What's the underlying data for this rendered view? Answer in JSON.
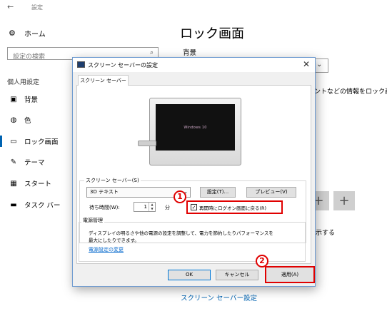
{
  "app": {
    "back_glyph": "←",
    "title": "設定"
  },
  "nav": {
    "home": {
      "icon": "gear-icon",
      "glyph": "⚙",
      "label": "ホーム"
    },
    "search": {
      "placeholder": "設定の検索",
      "icon": "search-icon",
      "glyph": "⌕"
    },
    "section_label": "個人用設定",
    "items": [
      {
        "icon": "picture-icon",
        "glyph": "▣",
        "label": "背景"
      },
      {
        "icon": "palette-icon",
        "glyph": "◍",
        "label": "色"
      },
      {
        "icon": "lock-screen-icon",
        "glyph": "▭",
        "label": "ロック画面",
        "active": true
      },
      {
        "icon": "theme-icon",
        "glyph": "✎",
        "label": "テーマ"
      },
      {
        "icon": "start-icon",
        "glyph": "▦",
        "label": "スタート"
      },
      {
        "icon": "taskbar-icon",
        "glyph": "▬",
        "label": "タスク バー"
      }
    ]
  },
  "main": {
    "title": "ロック画面",
    "background_label": "背景",
    "dropdown_chevron": "⌄",
    "info_text_partial": "ントなどの情報をロック画",
    "tile_glyph": "+",
    "show_text_partial": "示する",
    "screen_saver_link": "スクリーン セーバー設定"
  },
  "dialog": {
    "title": "スクリーン セーバーの設定",
    "close_glyph": "✕",
    "tab": "スクリーン セーバー",
    "preview_text": "Windows 10",
    "screensaver_group": "スクリーン セーバー(S)",
    "selected_screensaver": "3D テキスト",
    "select_chevron": "⌄",
    "settings_button": "設定(T)...",
    "preview_button": "プレビュー(V)",
    "wait_label": "待ち時間(W):",
    "wait_value": "1",
    "wait_unit": "分",
    "resume_checked_glyph": "✓",
    "resume_label": "再開時にログオン画面に戻る(R)",
    "power_group": "電源管理",
    "power_desc": "ディスプレイの明るさや他の電源の設定を調整して、電力を節約したりパフォーマンスを最大にしたりできます。",
    "power_link": "電源設定の変更",
    "ok": "OK",
    "cancel": "キャンセル",
    "apply": "適用(A)",
    "annotation_1": "1",
    "annotation_2": "2"
  },
  "colors": {
    "accent": "#0063b1",
    "highlight": "#e00000"
  }
}
